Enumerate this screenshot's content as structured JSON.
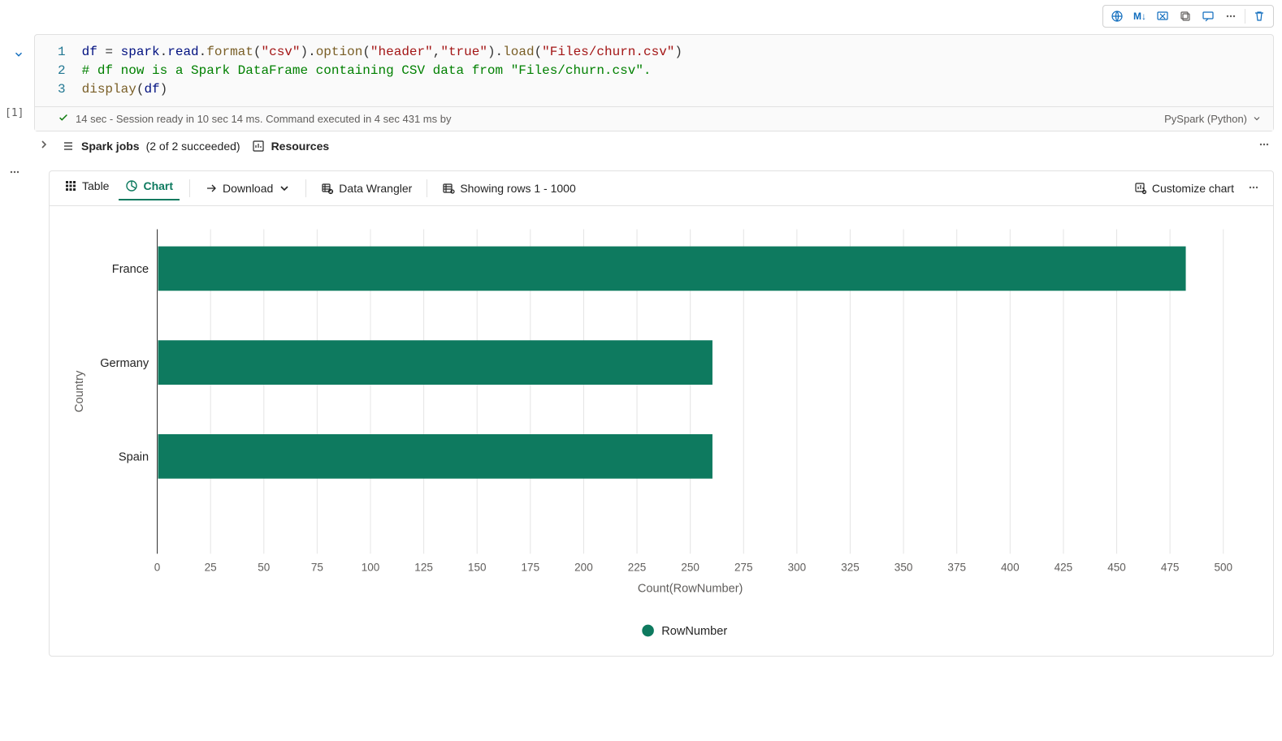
{
  "toolbar_icons": [
    "globe",
    "markdown",
    "clear-output",
    "copy",
    "comment",
    "more",
    "delete"
  ],
  "cell_index": "[1]",
  "code": {
    "lines": [
      {
        "n": "1",
        "segments": [
          [
            "df",
            "var"
          ],
          [
            " = ",
            "op"
          ],
          [
            "spark",
            "var"
          ],
          [
            ".",
            "op"
          ],
          [
            "read",
            "var"
          ],
          [
            ".",
            "op"
          ],
          [
            "format",
            "fn"
          ],
          [
            "(",
            "op"
          ],
          [
            "\"csv\"",
            "str"
          ],
          [
            ").",
            "op"
          ],
          [
            "option",
            "fn"
          ],
          [
            "(",
            "op"
          ],
          [
            "\"header\"",
            "str"
          ],
          [
            ",",
            "op"
          ],
          [
            "\"true\"",
            "str"
          ],
          [
            ").",
            "op"
          ],
          [
            "load",
            "fn"
          ],
          [
            "(",
            "op"
          ],
          [
            "\"Files/churn.csv\"",
            "str"
          ],
          [
            ")",
            "op"
          ]
        ]
      },
      {
        "n": "2",
        "segments": [
          [
            "# df now is a Spark DataFrame containing CSV data from \"Files/churn.csv\".",
            "cmt"
          ]
        ]
      },
      {
        "n": "3",
        "segments": [
          [
            "display",
            "fn"
          ],
          [
            "(",
            "op"
          ],
          [
            "df",
            "var"
          ],
          [
            ")",
            "op"
          ]
        ]
      }
    ]
  },
  "status": {
    "text": "14 sec - Session ready in 10 sec 14 ms. Command executed in 4 sec 431 ms by",
    "kernel": "PySpark (Python)"
  },
  "jobs": {
    "spark_label": "Spark jobs",
    "spark_status": "(2 of 2 succeeded)",
    "resources_label": "Resources"
  },
  "output_toolbar": {
    "table": "Table",
    "chart": "Chart",
    "download": "Download",
    "data_wrangler": "Data Wrangler",
    "rows": "Showing rows 1 - 1000",
    "customize": "Customize chart"
  },
  "chart_data": {
    "type": "bar",
    "orientation": "horizontal",
    "categories": [
      "France",
      "Germany",
      "Spain"
    ],
    "values": [
      482,
      260,
      260
    ],
    "xlabel": "Count(RowNumber)",
    "ylabel": "Country",
    "xlim": [
      0,
      500
    ],
    "xticks": [
      0,
      25,
      50,
      75,
      100,
      125,
      150,
      175,
      200,
      225,
      250,
      275,
      300,
      325,
      350,
      375,
      400,
      425,
      450,
      475,
      500
    ],
    "legend": "RowNumber",
    "series_color": "#0e7a5f"
  }
}
